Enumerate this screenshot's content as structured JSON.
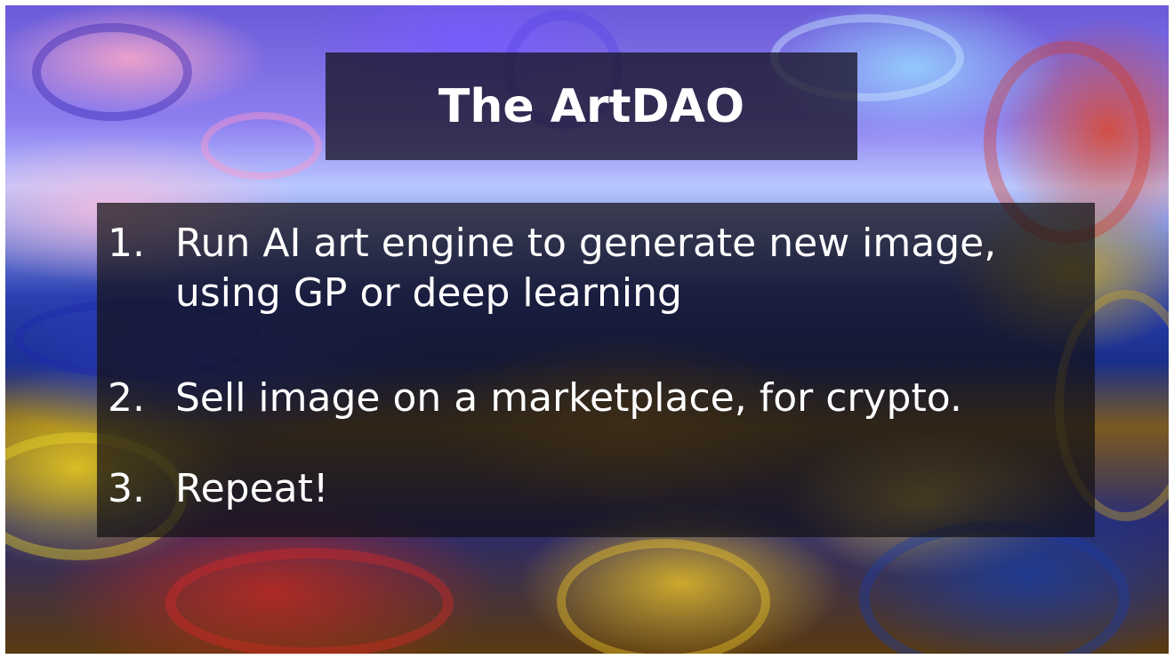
{
  "slide": {
    "title": "The ArtDAO",
    "items": [
      {
        "number": "1.",
        "text": "Run AI art engine to generate new image, using GP or deep learning"
      },
      {
        "number": "2.",
        "text": "Sell image on a marketplace, for crypto."
      },
      {
        "number": "3.",
        "text": "Repeat!"
      }
    ]
  },
  "colors": {
    "text": "#ffffff",
    "title_box": "#19162a",
    "list_box": "#141014"
  }
}
